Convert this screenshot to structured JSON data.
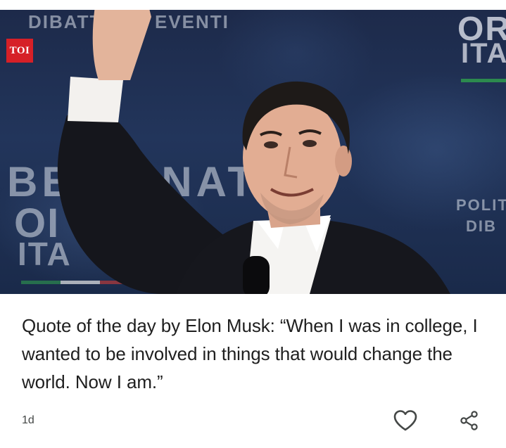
{
  "article": {
    "source_logo": "TOI",
    "image": {
      "background_text": {
        "line1_left": "DIBATT",
        "line1_right": "EVENTI",
        "top_right_1": "OR",
        "top_right_2": "ITA",
        "mid_left_1": "BE",
        "mid_left_2": "RNATO",
        "low_left_1": "OI",
        "low_left_2": "ITA",
        "right_1": "POLIT",
        "right_2": "DIB"
      }
    },
    "headline": "Quote of the day by Elon Musk: “When I was in college, I wanted to be involved in things that would change the world. Now I am.”",
    "age": "1d"
  },
  "actions": {
    "like_icon": "heart-outline-icon",
    "share_icon": "share-icon"
  },
  "colors": {
    "logo_red": "#d62027",
    "text": "#1f1f1f",
    "muted": "#444746"
  }
}
